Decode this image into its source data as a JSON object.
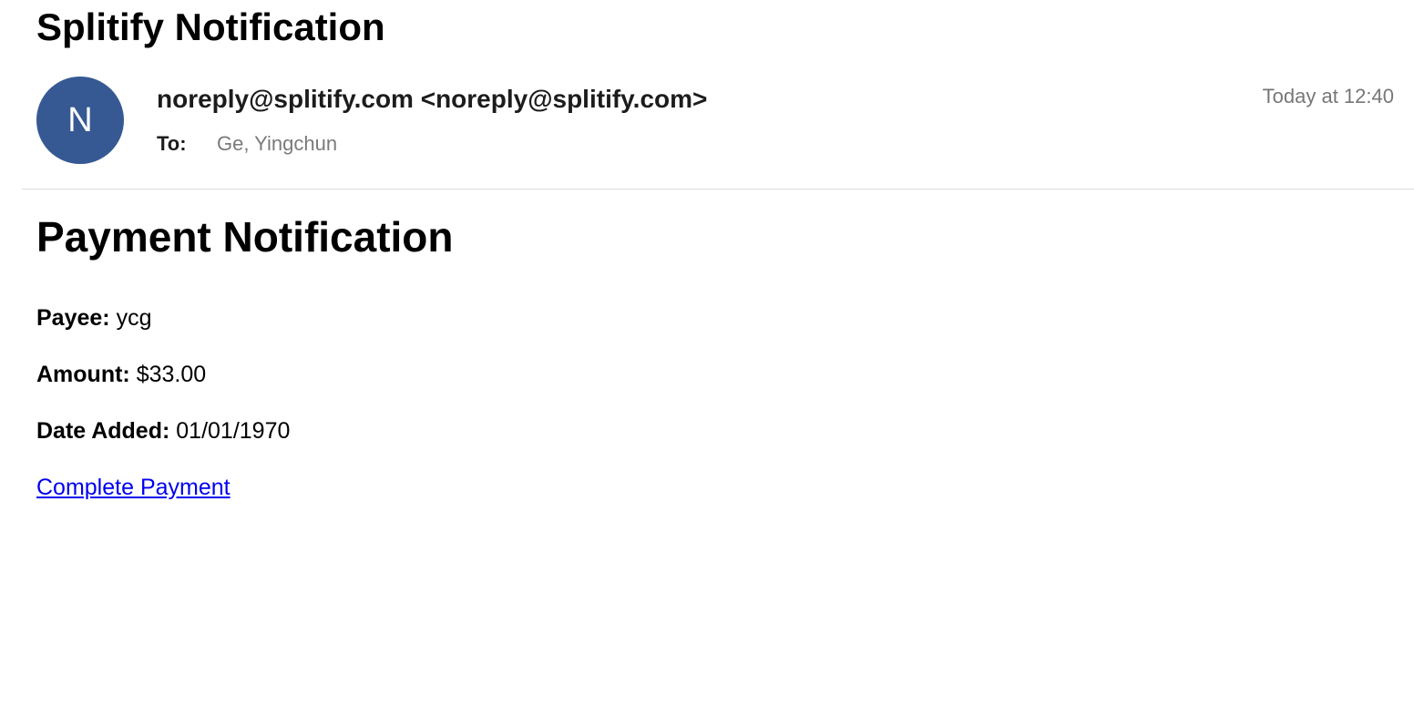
{
  "email": {
    "subject": "Splitify Notification",
    "avatar_initial": "N",
    "from": "noreply@splitify.com <noreply@splitify.com>",
    "to_label": "To:",
    "to_value": "Ge, Yingchun",
    "timestamp": "Today at 12:40"
  },
  "content": {
    "title": "Payment Notification",
    "payee_label": "Payee:",
    "payee_value": "ycg",
    "amount_label": "Amount:",
    "amount_value": "$33.00",
    "date_label": "Date Added:",
    "date_value": "01/01/1970",
    "link_label": "Complete Payment"
  },
  "colors": {
    "avatar": "#365993",
    "link": "#0000ee",
    "muted": "#777777"
  }
}
